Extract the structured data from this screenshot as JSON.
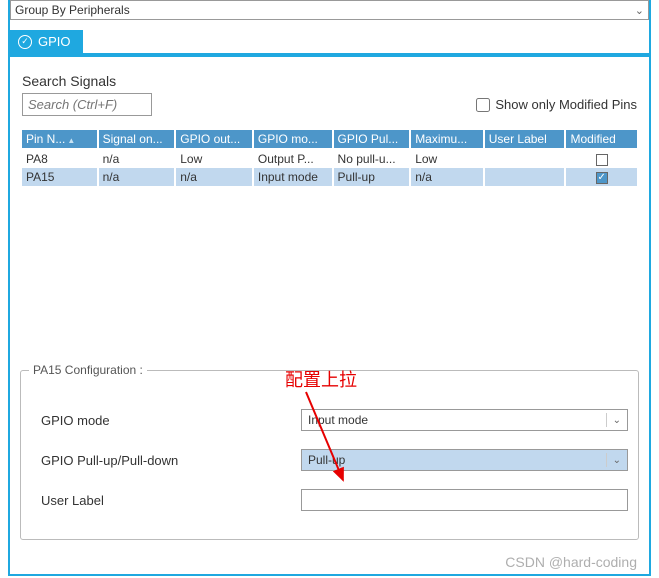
{
  "group_by": "Group By Peripherals",
  "tab": {
    "label": "GPIO"
  },
  "search": {
    "label": "Search Signals",
    "placeholder": "Search (Ctrl+F)",
    "value": ""
  },
  "show_modified_label": "Show only Modified Pins",
  "table": {
    "headers": [
      "Pin N...",
      "Signal on...",
      "GPIO out...",
      "GPIO mo...",
      "GPIO Pul...",
      "Maximu...",
      "User Label",
      "Modified"
    ],
    "rows": [
      {
        "pin": "PA8",
        "signal": "n/a",
        "out": "Low",
        "mode": "Output P...",
        "pull": "No pull-u...",
        "max": "Low",
        "label": "",
        "modified": false,
        "selected": false
      },
      {
        "pin": "PA15",
        "signal": "n/a",
        "out": "n/a",
        "mode": "Input mode",
        "pull": "Pull-up",
        "max": "n/a",
        "label": "",
        "modified": true,
        "selected": true
      }
    ]
  },
  "config": {
    "title": "PA15 Configuration :",
    "mode_label": "GPIO mode",
    "mode_value": "Input mode",
    "pull_label": "GPIO Pull-up/Pull-down",
    "pull_value": "Pull-up",
    "userlabel_label": "User Label",
    "userlabel_value": ""
  },
  "annotation_text": "配置上拉",
  "watermark": "CSDN @hard-coding",
  "colors": {
    "accent": "#1fa8e0",
    "header": "#4d96c9",
    "selection": "#c1d8ee"
  }
}
